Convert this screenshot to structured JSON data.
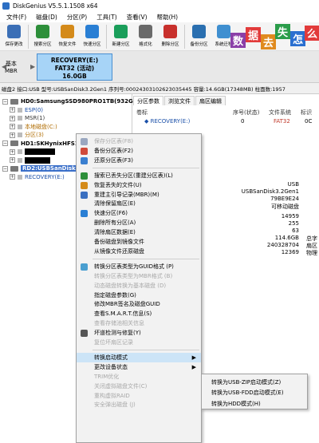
{
  "app": {
    "title": "DiskGenius V5.5.1.1508 x64"
  },
  "menu": [
    "文件(F)",
    "磁盘(D)",
    "分区(P)",
    "工具(T)",
    "查看(V)",
    "帮助(H)"
  ],
  "toolbar": [
    {
      "label": "保存更改",
      "icon": "save-icon",
      "color": "#3b6fb6"
    },
    {
      "label": "搜索分区",
      "icon": "search-icon",
      "color": "#2d8f3a"
    },
    {
      "label": "恢复文件",
      "icon": "recover-icon",
      "color": "#d48a1a"
    },
    {
      "label": "快速分区",
      "icon": "quick-partition-icon",
      "color": "#2a7fd4"
    },
    {
      "label": "新建分区",
      "icon": "new-partition-icon",
      "color": "#1a9e5a"
    },
    {
      "label": "格式化",
      "icon": "format-icon",
      "color": "#6a6a6a"
    },
    {
      "label": "删除分区",
      "icon": "delete-icon",
      "color": "#c8302c"
    },
    {
      "label": "备份分区",
      "icon": "backup-icon",
      "color": "#2a6fb0"
    },
    {
      "label": "系统迁移",
      "icon": "migrate-icon",
      "color": "#3f8fd0"
    }
  ],
  "ad": {
    "chars": [
      {
        "text": "数",
        "color": "#8b3fa8"
      },
      {
        "text": "据",
        "color": "#e23b3b"
      },
      {
        "text": "去",
        "color": "#e08a1e"
      },
      {
        "text": "失",
        "color": "#2a9d4a"
      },
      {
        "text": "怎",
        "color": "#2a6fd0"
      },
      {
        "text": "么",
        "color": "#e23b3b"
      }
    ]
  },
  "diskbar": {
    "type_line1": "基本",
    "type_line2": "MBR",
    "partition_name": "RECOVERY(E:)",
    "partition_fs": "FAT32 (活动)",
    "partition_size": "16.0GB"
  },
  "infobar": "磁盘2 接口:USB 型号:USBSanDisk3.2Gen1 序列号:00024303102623035445 容量:14.6GB(17348MB) 柱面数:1957",
  "tree": [
    {
      "text": "HD0:SamsungSSD980PRO1TB(932GB)",
      "bold": true,
      "indent": 3,
      "expander": "−",
      "icon": "disk"
    },
    {
      "text": "ESP(0)",
      "indent": 12,
      "expander": "+",
      "color": "#1a4fa8"
    },
    {
      "text": "MSR(1)",
      "indent": 12,
      "expander": "+",
      "color": "#333"
    },
    {
      "text": "本地磁盘(C:)",
      "indent": 12,
      "expander": "+",
      "color": "#b06c00"
    },
    {
      "text": "分区(3)",
      "indent": 12,
      "expander": "+",
      "color": "#b06c00"
    },
    {
      "text": "HD1:SKHynixHFS1",
      "bold": true,
      "indent": 3,
      "expander": "−",
      "icon": "disk"
    },
    {
      "text": "",
      "indent": 12,
      "expander": "+",
      "redacted": true
    },
    {
      "text": "",
      "indent": 12,
      "expander": "+",
      "redacted": true
    },
    {
      "text": "RD2:USBSanDisk3.2",
      "bold": true,
      "indent": 3,
      "expander": "−",
      "icon": "disk",
      "selected": true
    },
    {
      "text": "RECOVERY(E:)",
      "indent": 12,
      "expander": "+",
      "color": "#1a4fa8"
    }
  ],
  "tabs": [
    "分区参数",
    "浏览文件",
    "扇区编辑"
  ],
  "columns": {
    "label": "卷标",
    "seq": "序号(状态)",
    "fs": "文件系统",
    "id": "标识"
  },
  "partition_row": {
    "label": "RECOVERY(E:)",
    "seq": "0",
    "fs": "FAT32",
    "id": "0C"
  },
  "disk_info": {
    "iface": "USB",
    "model": "USBSanDisk3.2Gen1",
    "serial_frag": "79BE9E24",
    "type": "可移动磁盘",
    "cylinders": "14959",
    "heads": "255",
    "sectors": "63",
    "capacity": "114.6GB",
    "total_sectors": "240328704",
    "extra": "12369",
    "side_total": "总字",
    "side_sector": "扇区",
    "side_phys": "物理"
  },
  "context_menu": [
    {
      "label": "保存分区表(F8)",
      "disabled": true,
      "icon": "save-icon",
      "iconColor": "#9aa7c0"
    },
    {
      "label": "备份分区表(F2)",
      "icon": "backup-table-icon",
      "iconColor": "#d04a3a"
    },
    {
      "label": "还原分区表(F3)",
      "icon": "restore-table-icon",
      "iconColor": "#3a7fd0"
    },
    {
      "sep": true
    },
    {
      "label": "搜索已丢失分区(重建分区表)(L)",
      "icon": "search-lost-icon",
      "iconColor": "#2d8f3a"
    },
    {
      "label": "恢复丢失的文件(U)",
      "icon": "recover-files-icon",
      "iconColor": "#d48a1a"
    },
    {
      "label": "重建主引导记录(MBR)(M)",
      "icon": "rebuild-mbr-icon",
      "iconColor": "#3a6fc0"
    },
    {
      "label": "清除保留扇区(E)"
    },
    {
      "label": "快速分区(F6)",
      "icon": "quick-partition-icon",
      "iconColor": "#2a7fd4"
    },
    {
      "label": "删除所有分区(A)"
    },
    {
      "label": "清除扇区数据(E)"
    },
    {
      "label": "备份磁盘到镜像文件"
    },
    {
      "label": "从镜像文件还原磁盘"
    },
    {
      "sep": true
    },
    {
      "label": "转换分区表类型为GUID格式 (P)",
      "icon": "convert-guid-icon",
      "iconColor": "#4a9fd0"
    },
    {
      "label": "转换分区表类型为MBR格式 (B)",
      "disabled": true
    },
    {
      "label": "动态磁盘转换为基本磁盘 (D)",
      "disabled": true
    },
    {
      "label": "指定磁盘参数(G)"
    },
    {
      "label": "修改MBR签名及磁盘GUID"
    },
    {
      "label": "查看S.M.A.R.T.信息(S)"
    },
    {
      "label": "查看存储池相关信息",
      "disabled": true
    },
    {
      "label": "坏道检测与修复(Y)",
      "icon": "bad-sector-icon",
      "iconColor": "#555"
    },
    {
      "label": "复位坏扇区记录",
      "disabled": true
    },
    {
      "sep": true
    },
    {
      "label": "转换启动模式",
      "highlighted": true,
      "submenu": true
    },
    {
      "label": "更改设备状态",
      "submenu": true
    },
    {
      "label": "TRIM优化",
      "disabled": true
    },
    {
      "label": "关闭虚拟磁盘文件(C)",
      "disabled": true
    },
    {
      "label": "重构虚拟RAID",
      "disabled": true
    },
    {
      "label": "安全弹出磁盘 (J)",
      "disabled": true
    }
  ],
  "submenu": [
    {
      "label": "转换为USB-ZIP启动模式(Z)"
    },
    {
      "label": "转换为USB-FDD启动模式(E)"
    },
    {
      "label": "转换为HDD模式(H)"
    }
  ]
}
